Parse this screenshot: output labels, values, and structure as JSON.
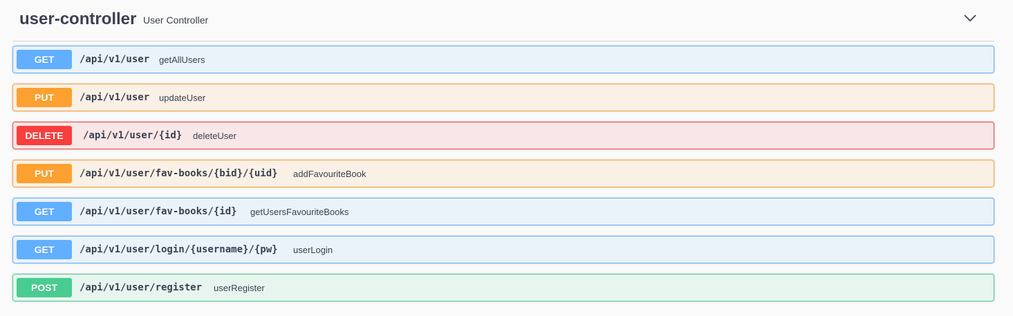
{
  "tag": {
    "name": "user-controller",
    "description": "User Controller",
    "toggle_icon": "chevron-down-icon"
  },
  "colors": {
    "get": "#61affe",
    "put": "#fca130",
    "delete": "#f93e3e",
    "post": "#49cc90",
    "text": "#3b4151"
  },
  "operations": [
    {
      "method": "GET",
      "path": "/api/v1/user",
      "summary": "getAllUsers"
    },
    {
      "method": "PUT",
      "path": "/api/v1/user",
      "summary": "updateUser"
    },
    {
      "method": "DELETE",
      "path": "/api/v1/user/{id}",
      "summary": "deleteUser"
    },
    {
      "method": "PUT",
      "path": "/api/v1/user/fav-books/{bid}/{uid}",
      "summary": "addFavouriteBook"
    },
    {
      "method": "GET",
      "path": "/api/v1/user/fav-books/{id}",
      "summary": "getUsersFavouriteBooks"
    },
    {
      "method": "GET",
      "path": "/api/v1/user/login/{username}/{pw}",
      "summary": "userLogin"
    },
    {
      "method": "POST",
      "path": "/api/v1/user/register",
      "summary": "userRegister"
    }
  ]
}
